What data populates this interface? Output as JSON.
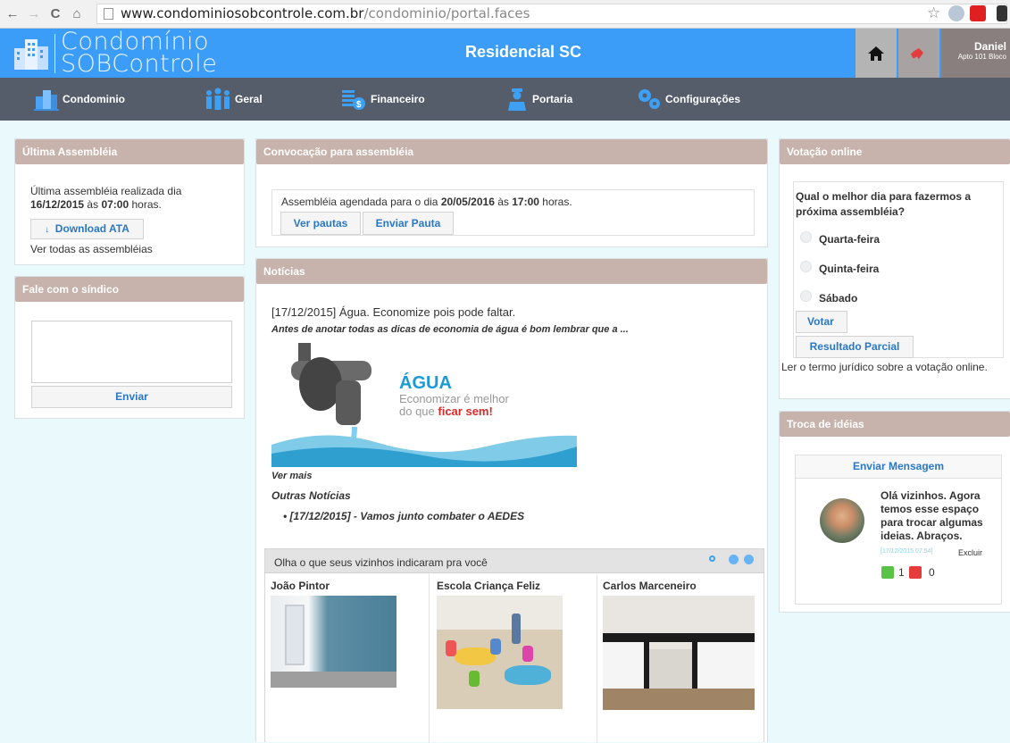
{
  "browser": {
    "url_host": "www.condominiosobcontrole.com.br",
    "url_path": "/condominio/portal.faces"
  },
  "header": {
    "logo_line1": "Condomínio",
    "logo_line2": "SOBControle",
    "title": "Residencial SC",
    "user_name": "Daniel",
    "user_apt": "Apto 101 Bloco"
  },
  "nav": {
    "items": [
      {
        "label": "Condominio",
        "icon": "building-icon"
      },
      {
        "label": "Geral",
        "icon": "people-icon"
      },
      {
        "label": "Financeiro",
        "icon": "money-icon"
      },
      {
        "label": "Portaria",
        "icon": "doorman-icon"
      },
      {
        "label": "Configurações",
        "icon": "gears-icon"
      }
    ]
  },
  "ultima": {
    "title": "Última Assembléia",
    "line1": "Última assembléia realizada dia",
    "date": "16/12/2015",
    "as": "às",
    "time": "07:00",
    "horas": "horas.",
    "download_label": "Download ATA",
    "see_all": "Ver todas as assembléias"
  },
  "fale": {
    "title": "Fale com o síndico",
    "send_label": "Enviar"
  },
  "convocacao": {
    "title": "Convocação para assembléia",
    "text": "Assembléia agendada para o dia",
    "date": "20/05/2016",
    "as": "às",
    "time": "17:00",
    "horas": "horas.",
    "ver_pautas": "Ver pautas",
    "enviar_pauta": "Enviar Pauta"
  },
  "noticias": {
    "title": "Notícias",
    "headline": "[17/12/2015] Água. Economize pois pode faltar.",
    "excerpt": "Antes de anotar todas as dicas de economia de água é bom lembrar que a ...",
    "image_title": "ÁGUA",
    "image_line1": "Economizar é melhor",
    "image_line2_a": "do que",
    "image_line2_b": "ficar sem!",
    "ver_mais": "Ver mais",
    "outras_title": "Outras Notícias",
    "outras": [
      "[17/12/2015] - Vamos junto combater o AEDES"
    ]
  },
  "indicacoes": {
    "title": "Olha o que seus vizinhos indicaram pra você",
    "items": [
      "João Pintor",
      "Escola Criança Feliz",
      "Carlos Marceneiro"
    ]
  },
  "votacao": {
    "title": "Votação online",
    "question": "Qual o melhor dia para fazermos a próxima assembléia?",
    "options": [
      "Quarta-feira",
      "Quinta-feira",
      "Sábado"
    ],
    "vote_label": "Votar",
    "result_label": "Resultado Parcial",
    "terms": "Ler o termo jurídico sobre a votação online."
  },
  "troca": {
    "title": "Troca de idéias",
    "send_label": "Enviar Mensagem",
    "message": "Olá vizinhos. Agora temos esse espaço para trocar algumas ideias. Abraços.",
    "timestamp": "[17/12/2015 07:54]",
    "delete_label": "Excluir",
    "likes": "1",
    "dislikes": "0"
  },
  "colors": {
    "header_blue": "#3c9df8",
    "nav_gray": "#555d6b",
    "panel_header": "#c7b3ac",
    "link_blue": "#2a78c4"
  }
}
